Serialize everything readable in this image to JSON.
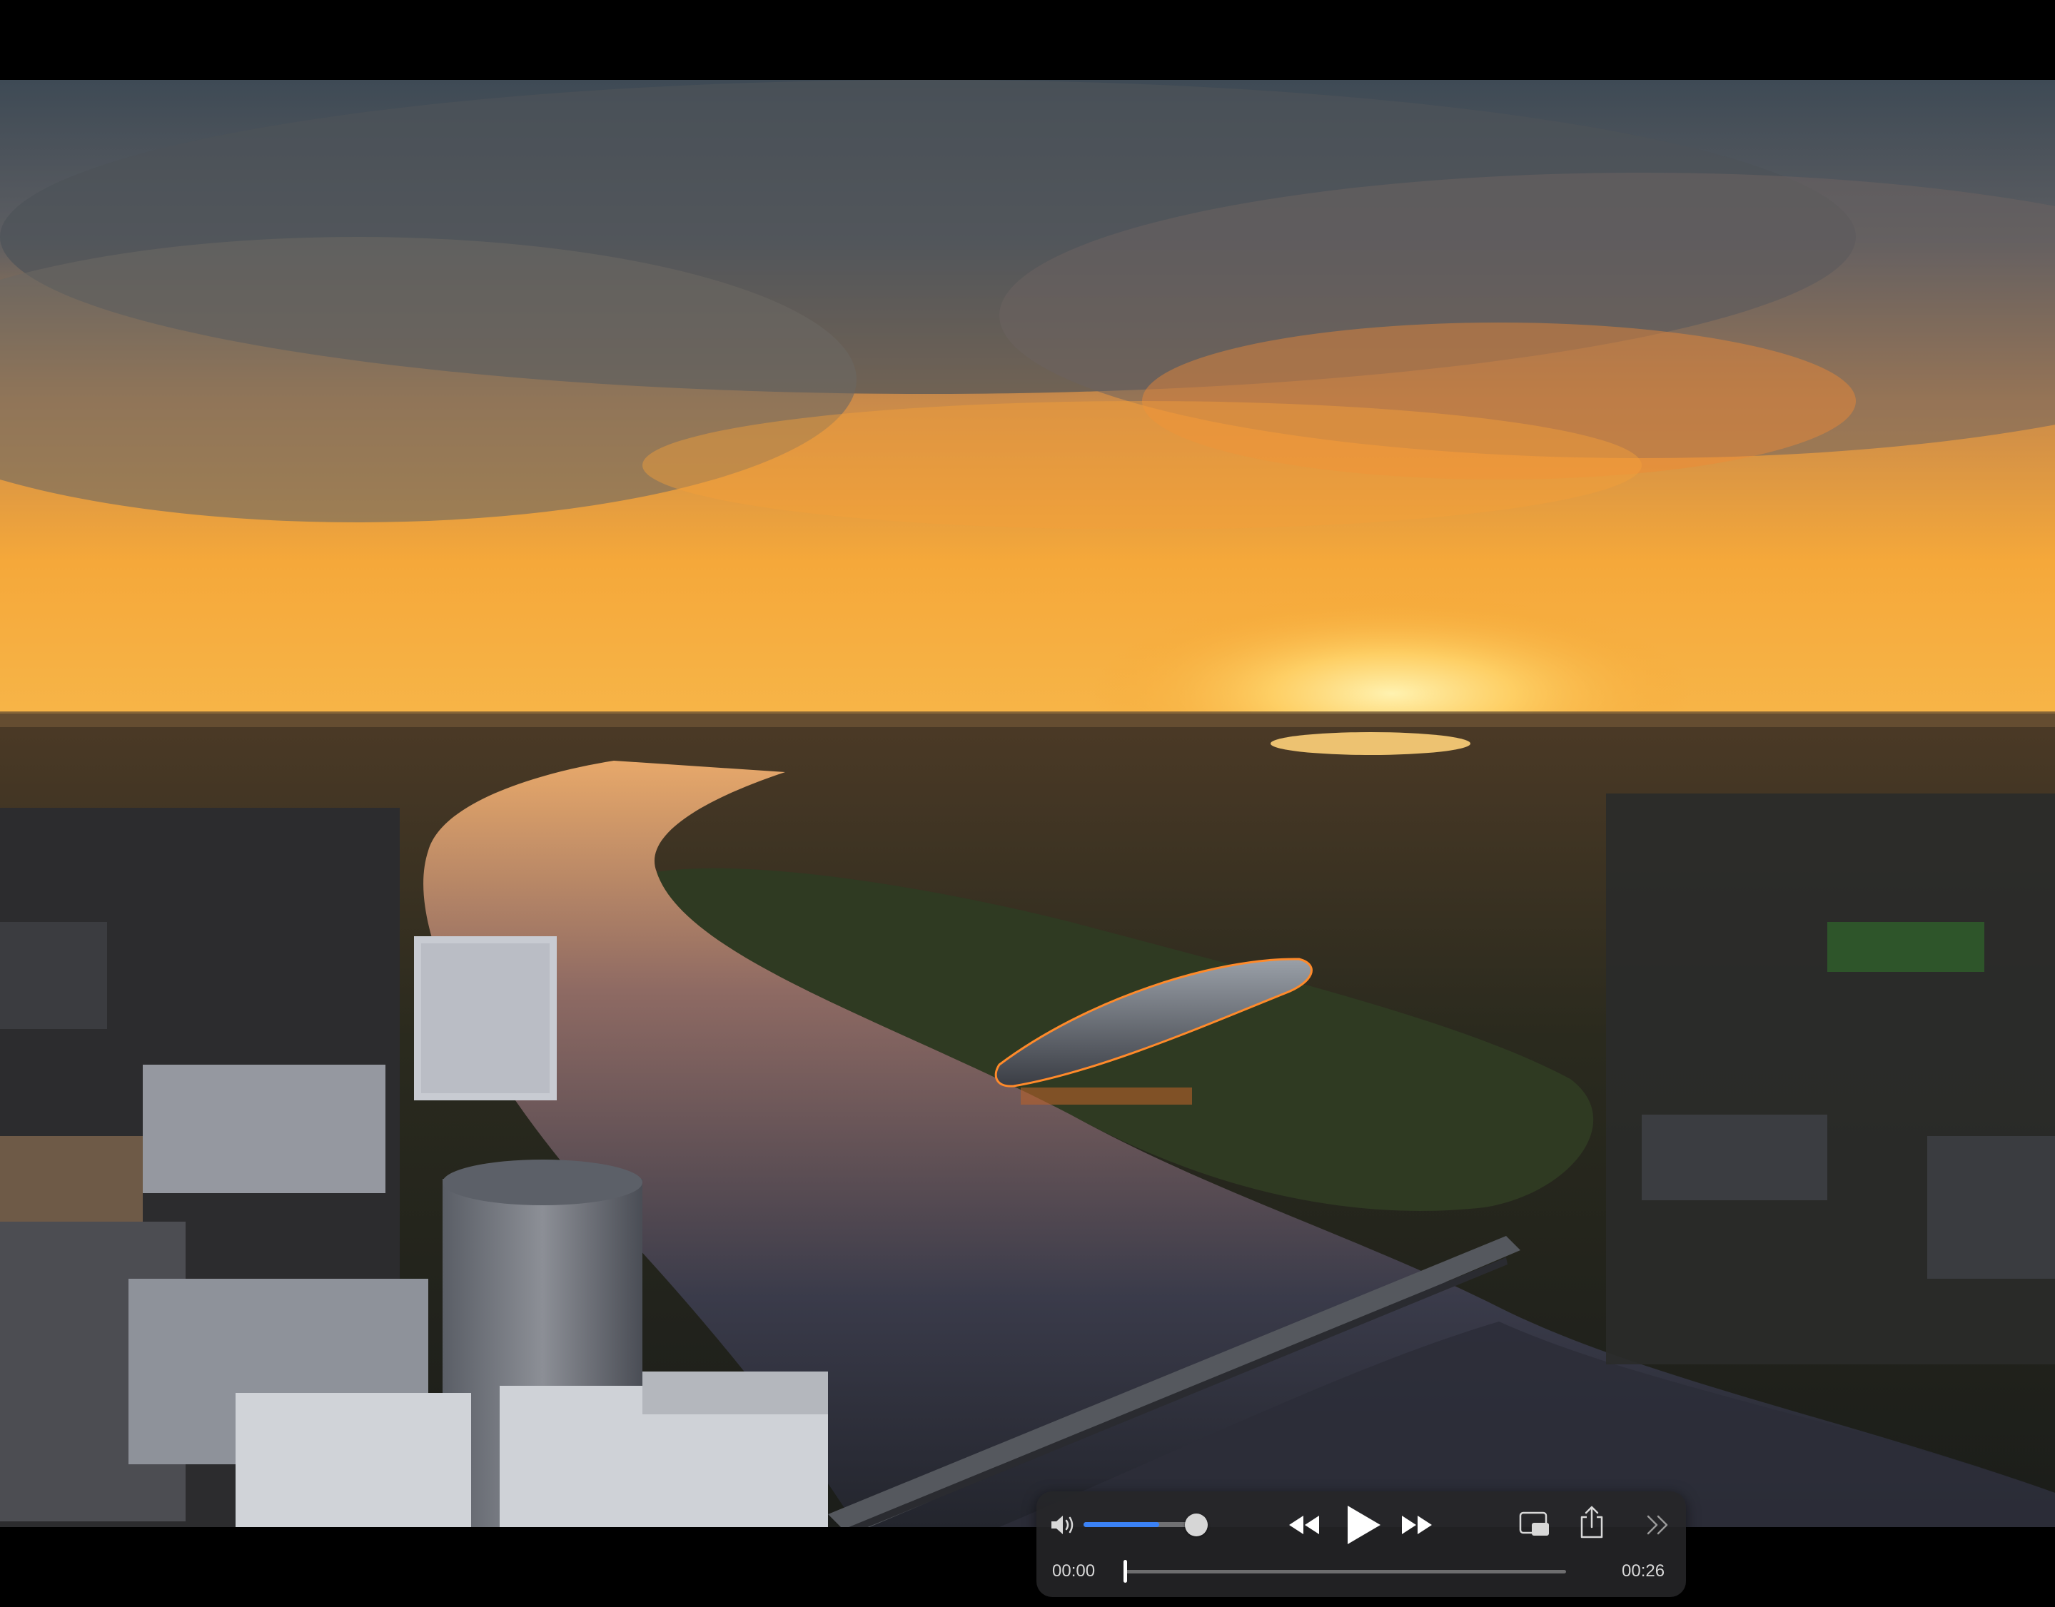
{
  "player": {
    "elapsed_time": "00:00",
    "total_time": "00:26",
    "volume_level": 0.68,
    "playback_progress": 0.0,
    "icons": {
      "volume": "speaker-wave-icon",
      "rewind": "rewind-icon",
      "play": "play-icon",
      "forward": "fast-forward-icon",
      "pip": "picture-in-picture-icon",
      "share": "share-icon",
      "more": "chevron-double-right-icon"
    },
    "colors": {
      "panel": "#262628",
      "volume_fill": "#3b82f6",
      "scrub_fill": "#ffffff",
      "text": "#d8d8d8"
    }
  }
}
